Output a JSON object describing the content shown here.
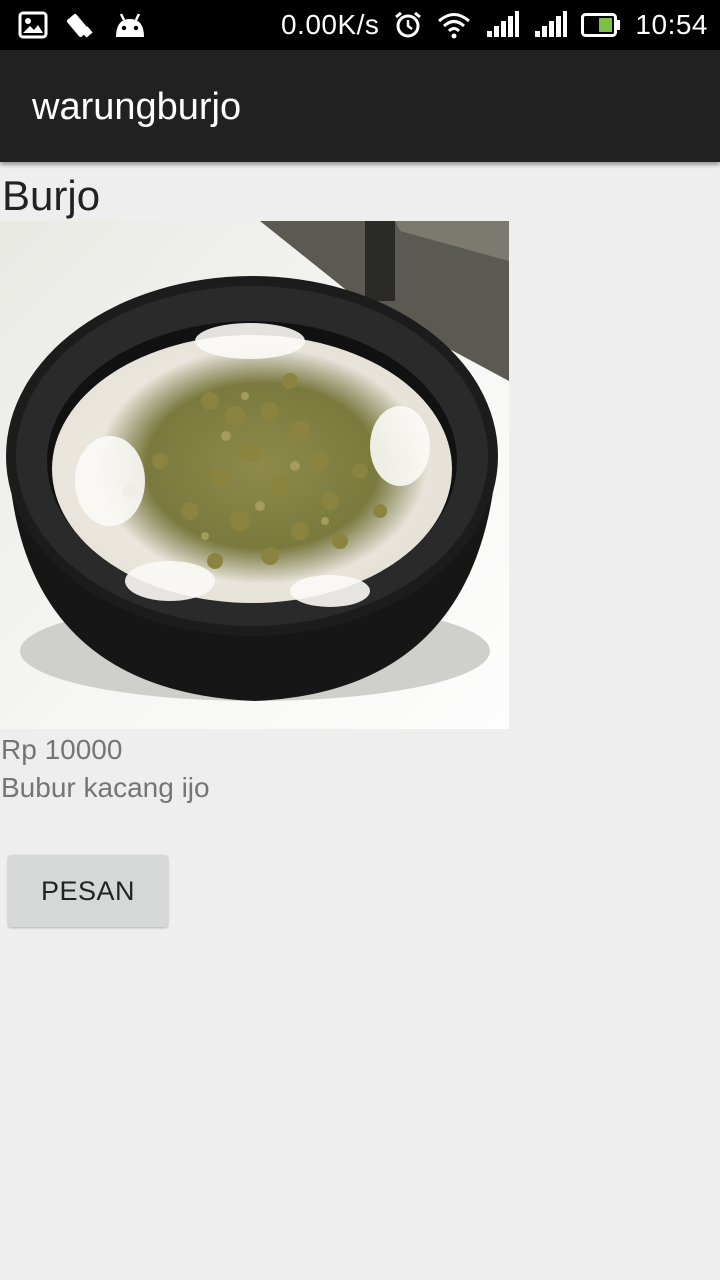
{
  "status_bar": {
    "icons": [
      "image-notification-icon",
      "bug-notification-icon",
      "android-notification-icon",
      "alarm-icon",
      "wifi-icon",
      "signal-icon",
      "signal-icon-2",
      "battery-icon"
    ],
    "network_speed": "0.00K/s",
    "time": "10:54"
  },
  "app_bar": {
    "title": "warungburjo"
  },
  "item": {
    "name": "Burjo",
    "image_description": "mung bean porridge in black bowl",
    "price": "Rp 10000",
    "description": "Bubur kacang ijo"
  },
  "actions": {
    "order_label": "PESAN"
  },
  "colors": {
    "status_bar_bg": "#000000",
    "app_bar_bg": "#212121",
    "page_bg": "#eeeeee",
    "button_bg": "#d6d7d7",
    "secondary_text": "#757575",
    "battery_fill": "#7ac143"
  }
}
